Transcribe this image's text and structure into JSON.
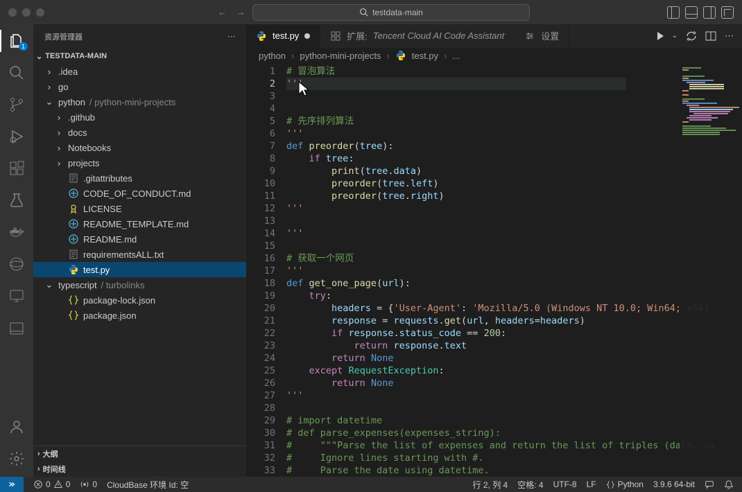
{
  "titlebar": {
    "search": "testdata-main"
  },
  "sidebar": {
    "title": "资源管理器",
    "section": "TESTDATA-MAIN",
    "outline": "大纲",
    "timeline": "时间线",
    "tree": [
      {
        "d": 1,
        "t": "folder-closed",
        "label": ".idea"
      },
      {
        "d": 1,
        "t": "folder-closed",
        "label": "go"
      },
      {
        "d": 1,
        "t": "folder-open",
        "label": "python",
        "suffix": " / python-mini-projects"
      },
      {
        "d": 2,
        "t": "folder-closed",
        "label": ".github"
      },
      {
        "d": 2,
        "t": "folder-closed",
        "label": "docs"
      },
      {
        "d": 2,
        "t": "folder-closed",
        "label": "Notebooks"
      },
      {
        "d": 2,
        "t": "folder-closed",
        "label": "projects"
      },
      {
        "d": 2,
        "t": "file-txt",
        "label": ".gitattributes"
      },
      {
        "d": 2,
        "t": "file-md",
        "label": "CODE_OF_CONDUCT.md"
      },
      {
        "d": 2,
        "t": "file-lic",
        "label": "LICENSE"
      },
      {
        "d": 2,
        "t": "file-md",
        "label": "README_TEMPLATE.md"
      },
      {
        "d": 2,
        "t": "file-md",
        "label": "README.md"
      },
      {
        "d": 2,
        "t": "file-txt",
        "label": "requirementsALL.txt"
      },
      {
        "d": 2,
        "t": "file-py",
        "label": "test.py",
        "sel": true
      },
      {
        "d": 1,
        "t": "folder-open",
        "label": "typescript",
        "suffix": " / turbolinks"
      },
      {
        "d": 2,
        "t": "file-json",
        "label": "package-lock.json"
      },
      {
        "d": 2,
        "t": "file-json",
        "label": "package.json"
      }
    ]
  },
  "tabs": {
    "file": "test.py",
    "ext_prefix": "扩展:",
    "ext_label": "Tencent Cloud AI Code Assistant",
    "settings": "设置"
  },
  "breadcrumbs": [
    "python",
    "python-mini-projects",
    "test.py",
    "..."
  ],
  "code": {
    "lines": [
      {
        "n": 1,
        "html": "<span class='cmt'># 冒泡算法</span>"
      },
      {
        "n": 2,
        "html": "<span class='curline'><span class='str'>'''</span></span>"
      },
      {
        "n": 3,
        "html": ""
      },
      {
        "n": 4,
        "html": ""
      },
      {
        "n": 5,
        "html": "<span class='cmt'># 先序排列算法</span>"
      },
      {
        "n": 6,
        "html": "<span class='str'>'''</span>"
      },
      {
        "n": 7,
        "html": "<span class='kw2'>def</span> <span class='fn'>preorder</span>(<span class='var'>tree</span>):"
      },
      {
        "n": 8,
        "html": "    <span class='kw'>if</span> <span class='var'>tree</span>:"
      },
      {
        "n": 9,
        "html": "        <span class='fn'>print</span>(<span class='var'>tree</span>.<span class='var'>data</span>)"
      },
      {
        "n": 10,
        "html": "        <span class='fn'>preorder</span>(<span class='var'>tree</span>.<span class='var'>left</span>)"
      },
      {
        "n": 11,
        "html": "        <span class='fn'>preorder</span>(<span class='var'>tree</span>.<span class='var'>right</span>)"
      },
      {
        "n": 12,
        "html": "<span class='str'>'''</span>"
      },
      {
        "n": 13,
        "html": ""
      },
      {
        "n": 14,
        "html": "<span class='str'>'''</span>"
      },
      {
        "n": 15,
        "html": ""
      },
      {
        "n": 16,
        "html": "<span class='cmt'># 获取一个网页</span>"
      },
      {
        "n": 17,
        "html": "<span class='str'>'''</span>"
      },
      {
        "n": 18,
        "html": "<span class='kw2'>def</span> <span class='fn'>get_one_page</span>(<span class='var'>url</span>):"
      },
      {
        "n": 19,
        "html": "    <span class='kw'>try</span>:"
      },
      {
        "n": 20,
        "html": "        <span class='var'>headers</span> <span class='op'>=</span> {<span class='str'>'User-Agent'</span>: <span class='str'>'Mozilla/5.0 (Windows NT 10.0; Win64; x64)</span>"
      },
      {
        "n": 21,
        "html": "        <span class='var'>response</span> <span class='op'>=</span> <span class='var'>requests</span>.<span class='fn'>get</span>(<span class='var'>url</span>, <span class='var'>headers</span><span class='op'>=</span><span class='var'>headers</span>)"
      },
      {
        "n": 22,
        "html": "        <span class='kw'>if</span> <span class='var'>response</span>.<span class='var'>status_code</span> <span class='op'>==</span> <span class='num'>200</span>:"
      },
      {
        "n": 23,
        "html": "            <span class='kw'>return</span> <span class='var'>response</span>.<span class='var'>text</span>"
      },
      {
        "n": 24,
        "html": "        <span class='kw'>return</span> <span class='kw2'>None</span>"
      },
      {
        "n": 25,
        "html": "    <span class='kw'>except</span> <span class='cls'>RequestException</span>:"
      },
      {
        "n": 26,
        "html": "        <span class='kw'>return</span> <span class='kw2'>None</span>"
      },
      {
        "n": 27,
        "html": "<span class='str'>'''</span>"
      },
      {
        "n": 28,
        "html": ""
      },
      {
        "n": 29,
        "html": "<span class='cmt'># import datetime</span>"
      },
      {
        "n": 30,
        "html": "<span class='cmt'># def parse_expenses(expenses_string):</span>"
      },
      {
        "n": 31,
        "html": "<span class='cmt'>#     \"\"\"Parse the list of expenses and return the list of triples (date, va</span>"
      },
      {
        "n": 32,
        "html": "<span class='cmt'>#     Ignore lines starting with #.</span>"
      },
      {
        "n": 33,
        "html": "<span class='cmt'>#     Parse the date using datetime.</span>"
      }
    ]
  },
  "status": {
    "errors": "0",
    "warnings": "0",
    "ports": "0",
    "cloudbase": "CloudBase 环境 Id:  空",
    "lncol": "行 2, 列 4",
    "spaces": "空格: 4",
    "encoding": "UTF-8",
    "eol": "LF",
    "lang": "Python",
    "py": "3.9.6 64-bit"
  },
  "activity_badge": "1"
}
